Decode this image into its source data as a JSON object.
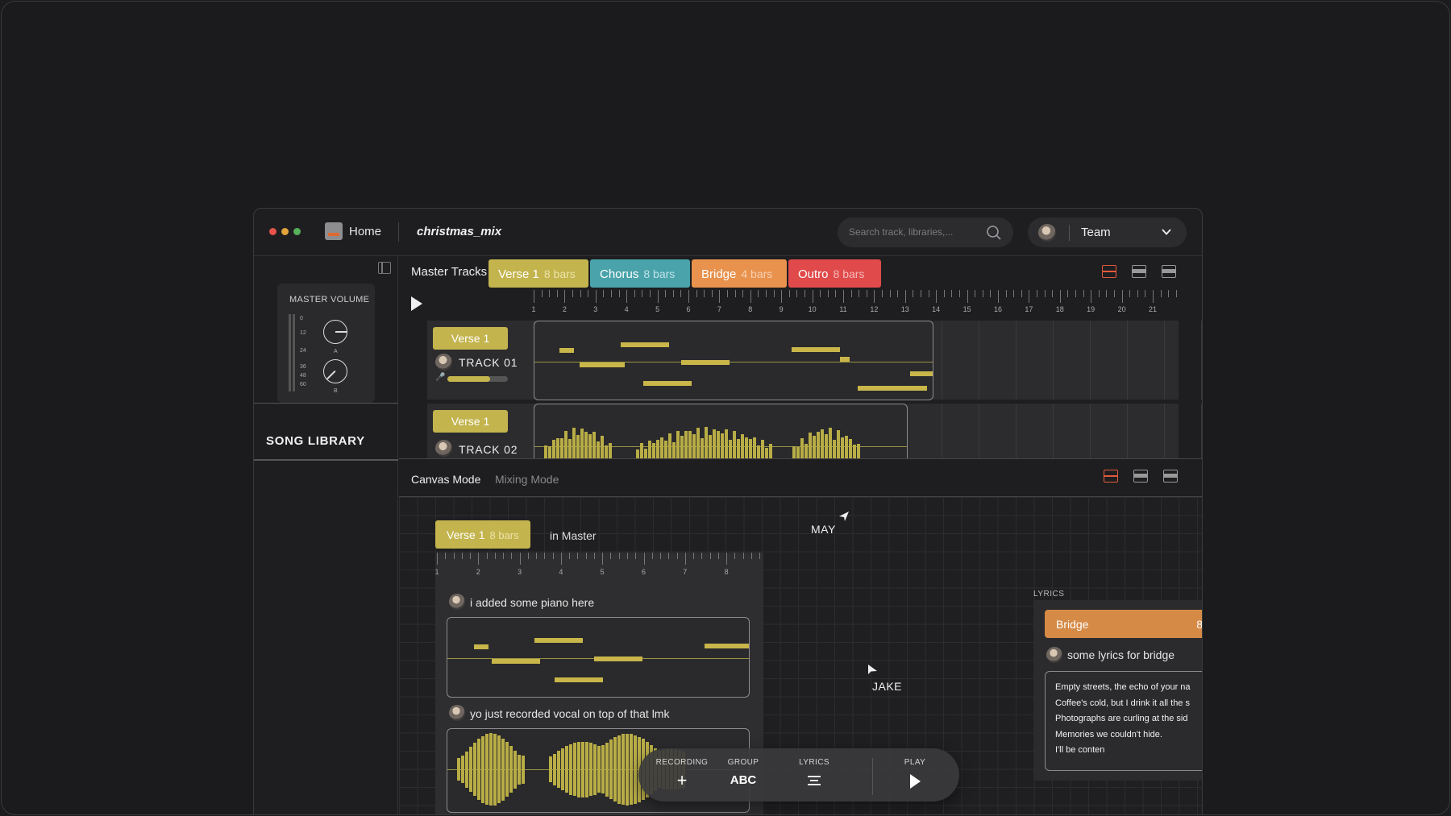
{
  "titlebar": {
    "home_label": "Home",
    "file_name": "christmas_mix",
    "search_placeholder": "Search track, libraries,...",
    "team_label": "Team",
    "traffic_lights": [
      "#e5534b",
      "#e0a43a",
      "#57b15a"
    ]
  },
  "sidebar": {
    "master_volume_title": "MASTER VOLUME",
    "scale": [
      "0",
      "12",
      "24",
      "36",
      "48",
      "60"
    ],
    "knob_a": "A",
    "knob_b": "B",
    "song_library": "SONG LIBRARY"
  },
  "master": {
    "label": "Master Tracks",
    "sections": [
      {
        "name": "Verse 1",
        "bars": "8 bars",
        "color": "#c3b44e"
      },
      {
        "name": "Chorus",
        "bars": "8 bars",
        "color": "#4aa3ab"
      },
      {
        "name": "Bridge",
        "bars": "4 bars",
        "color": "#e8924e"
      },
      {
        "name": "Outro",
        "bars": "8 bars",
        "color": "#e04a4a"
      }
    ],
    "ruler_numbers": [
      "1",
      "2",
      "3",
      "4",
      "5",
      "6",
      "7",
      "8",
      "9",
      "10",
      "11",
      "12",
      "13",
      "14",
      "15",
      "16",
      "17",
      "18",
      "19",
      "20",
      "21"
    ],
    "tracks": [
      {
        "section": "Verse 1",
        "name": "TRACK 01",
        "volume": 0.7
      },
      {
        "section": "Verse 1",
        "name": "TRACK 02"
      }
    ]
  },
  "canvas": {
    "mode_active": "Canvas Mode",
    "mode_inactive": "Mixing Mode",
    "verse_tag": {
      "name": "Verse 1",
      "bars": "8 bars"
    },
    "in_master": "in Master",
    "ruler_numbers": [
      "1",
      "2",
      "3",
      "4",
      "5",
      "6",
      "7",
      "8"
    ],
    "comment_1": "i added some piano here",
    "comment_2": "yo just recorded vocal on top of that lmk",
    "cursors": {
      "may": "MAY",
      "jake": "JAKE"
    },
    "lyrics": {
      "header": "LYRICS",
      "section": "Bridge",
      "section_bars": "8",
      "comment": "some lyrics for bridge",
      "lines": [
        "Empty streets, the echo of your na",
        "Coffee's cold, but I drink it all the s",
        "Photographs are curling at the sid",
        "Memories we couldn't hide.",
        "I'll be conten"
      ]
    },
    "toolbar": {
      "recording": "RECORDING",
      "group": "GROUP",
      "group_icon": "ABC",
      "lyrics": "LYRICS",
      "play": "PLAY"
    }
  },
  "accent": "#e25a3c"
}
